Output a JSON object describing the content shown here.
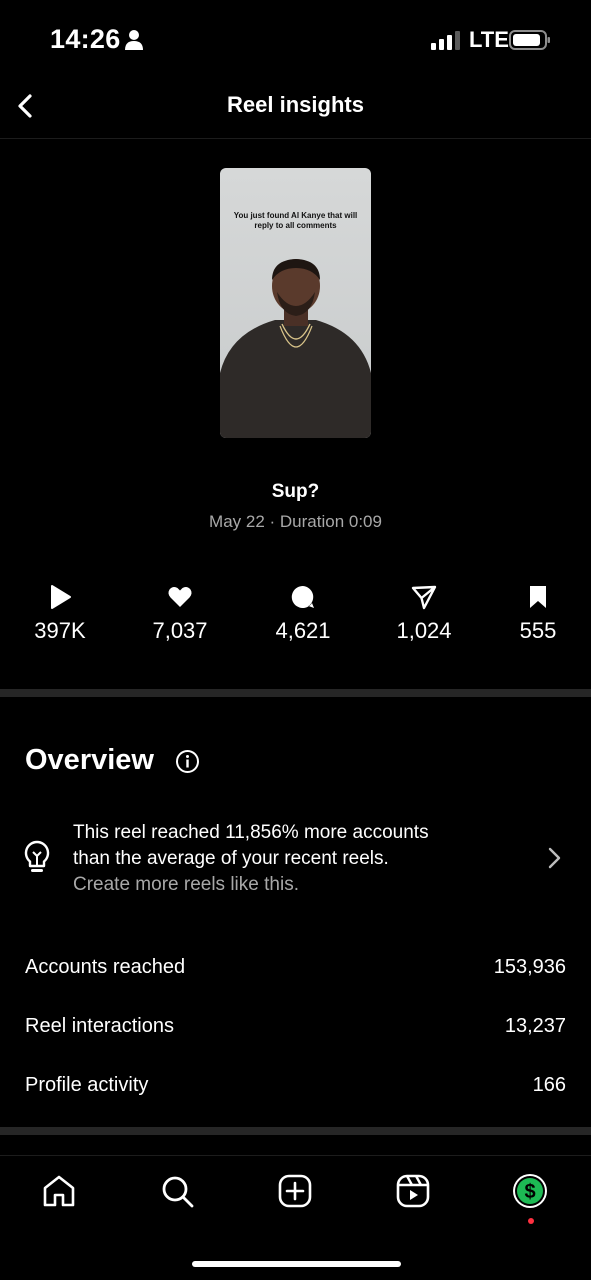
{
  "status_bar": {
    "time": "14:26",
    "network": "LTE",
    "icons": [
      "person-icon",
      "signal-icon",
      "battery-icon"
    ]
  },
  "header": {
    "title": "Reel insights",
    "back_icon": "chevron-left-icon"
  },
  "reel": {
    "thumbnail_caption": "You just found Al Kanye that will reply to all comments",
    "title": "Sup?",
    "meta": "May 22 · Duration 0:09"
  },
  "stats": [
    {
      "icon": "play-icon",
      "value": "397K"
    },
    {
      "icon": "heart-icon",
      "value": "7,037"
    },
    {
      "icon": "comment-icon",
      "value": "4,621"
    },
    {
      "icon": "share-icon",
      "value": "1,024"
    },
    {
      "icon": "bookmark-icon",
      "value": "555"
    }
  ],
  "overview": {
    "title": "Overview",
    "tip_line1": "This reel reached 11,856% more accounts",
    "tip_line2": "than the average of your recent reels.",
    "tip_link": "Create more reels like this.",
    "metrics": [
      {
        "label": "Accounts reached",
        "value": "153,936"
      },
      {
        "label": "Reel interactions",
        "value": "13,237"
      },
      {
        "label": "Profile activity",
        "value": "166"
      }
    ]
  },
  "nav": {
    "items": [
      "home-icon",
      "search-icon",
      "create-icon",
      "reels-icon",
      "profile-icon"
    ]
  },
  "colors": {
    "background": "#000000",
    "secondary_text": "#a8a8a8",
    "divider": "#262626",
    "profile_green": "#1db954",
    "notification": "#ff3040"
  }
}
